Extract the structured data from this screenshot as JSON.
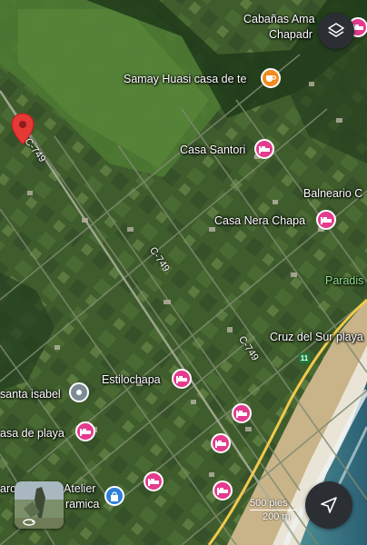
{
  "labels": {
    "cabanas": "Cabañas Ama",
    "chapadr": "Chapadr",
    "samay": "Samay Huasi casa de te",
    "santori": "Casa Santori",
    "balneario": "Balneario C",
    "nera": "Casa Nera Chapa",
    "paradise": "Paradis",
    "cruz": "Cruz del Sur playa",
    "estilochapa": "Estilochapa",
    "santa_isabel": "santa isabel",
    "casa_playa": "asa de playa",
    "atelier": "Atelier",
    "ceramica": "ramica",
    "arc": "arc"
  },
  "roads": {
    "c749_a": "C-749",
    "c749_b": "C-749",
    "c749_c": "C-749",
    "route_number": "11"
  },
  "scale": {
    "feet": "500 pies",
    "meters": "200 m"
  },
  "icons": {
    "layers": "layers-icon",
    "navigate": "navigation-arrow-icon",
    "location_pin": "location-pin-icon",
    "rotate": "rotate-360-icon"
  },
  "colors": {
    "hotel_pin": "#e43b8e",
    "cafe_pin": "#f28c1e",
    "location_pin": "#e53935",
    "shop_pin": "#2f7fd8",
    "highway": "#f2c94c"
  }
}
